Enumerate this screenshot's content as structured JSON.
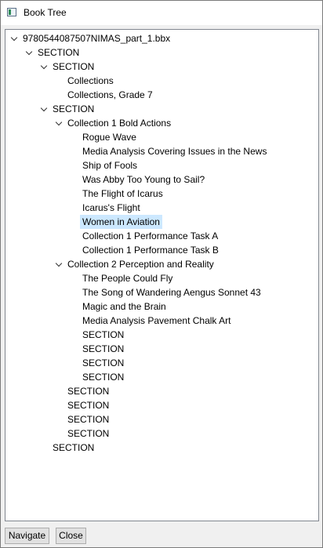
{
  "window": {
    "title": "Book Tree"
  },
  "tree": {
    "nodes": [
      {
        "label": "9780544087507NIMAS_part_1.bbx",
        "expanded": true
      },
      {
        "label": "SECTION",
        "expanded": true
      },
      {
        "label": "SECTION",
        "expanded": true
      },
      {
        "label": "Collections"
      },
      {
        "label": "Collections, Grade 7"
      },
      {
        "label": "SECTION",
        "expanded": true
      },
      {
        "label": "Collection 1 Bold Actions",
        "expanded": true
      },
      {
        "label": "Rogue Wave"
      },
      {
        "label": "Media Analysis Covering Issues in the News"
      },
      {
        "label": "Ship of Fools"
      },
      {
        "label": "Was Abby Too Young to Sail?"
      },
      {
        "label": "The Flight of Icarus"
      },
      {
        "label": "Icarus's Flight"
      },
      {
        "label": "Women in Aviation",
        "selected": true
      },
      {
        "label": "Collection 1 Performance Task A"
      },
      {
        "label": "Collection 1 Performance Task B"
      },
      {
        "label": "Collection 2 Perception and Reality",
        "expanded": true
      },
      {
        "label": "The People Could Fly"
      },
      {
        "label": "The Song of Wandering Aengus Sonnet 43"
      },
      {
        "label": "Magic and the Brain"
      },
      {
        "label": "Media Analysis Pavement Chalk Art"
      },
      {
        "label": "SECTION"
      },
      {
        "label": "SECTION"
      },
      {
        "label": "SECTION"
      },
      {
        "label": "SECTION"
      },
      {
        "label": "SECTION"
      },
      {
        "label": "SECTION"
      },
      {
        "label": "SECTION"
      },
      {
        "label": "SECTION"
      },
      {
        "label": "SECTION"
      }
    ],
    "selection_color": "#cce8ff"
  },
  "buttons": {
    "navigate_label": "Navigate",
    "close_label": "Close"
  },
  "icons": {
    "app": "book-tree-window-icon",
    "expander": "chevron-down-icon"
  }
}
